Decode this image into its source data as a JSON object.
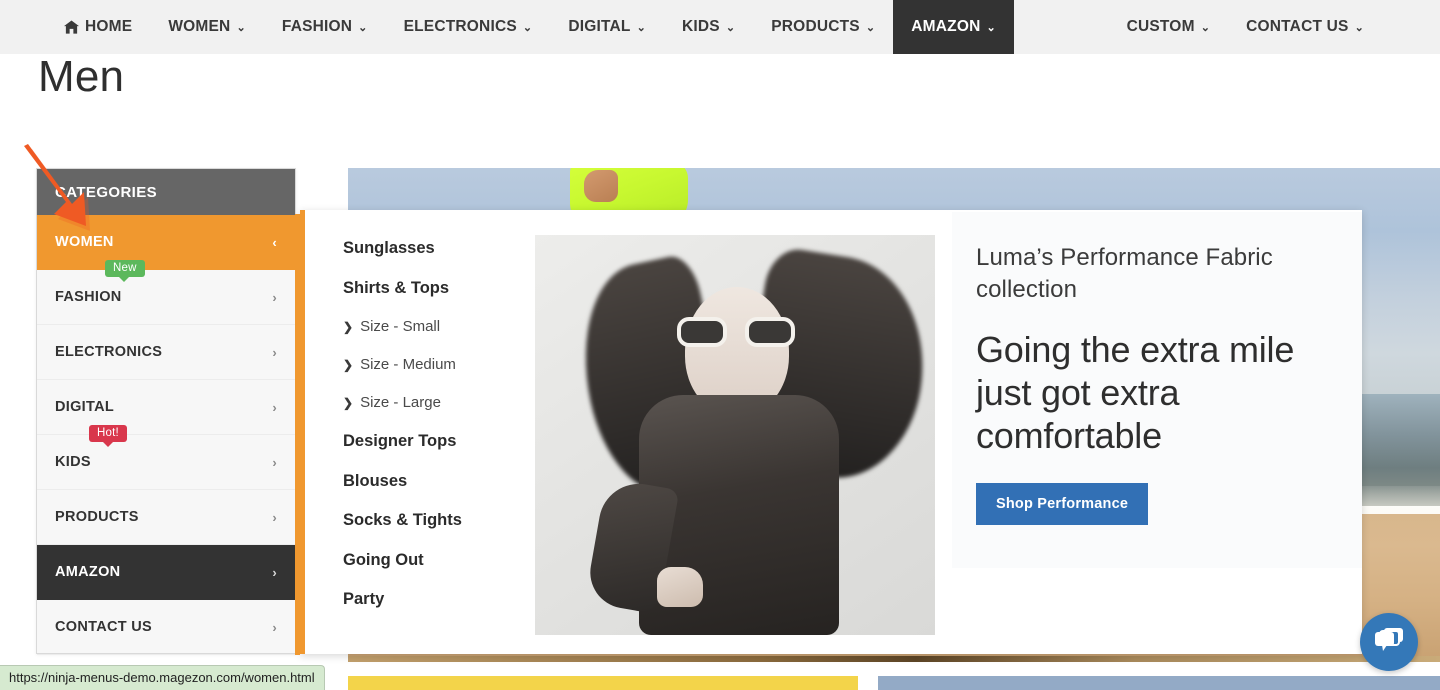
{
  "topnav": {
    "left_items": [
      {
        "label": "HOME",
        "icon": "home-icon",
        "caret": false,
        "active": false
      },
      {
        "label": "WOMEN",
        "icon": null,
        "caret": true,
        "active": false
      },
      {
        "label": "FASHION",
        "icon": null,
        "caret": true,
        "active": false
      },
      {
        "label": "ELECTRONICS",
        "icon": null,
        "caret": true,
        "active": false
      },
      {
        "label": "DIGITAL",
        "icon": null,
        "caret": true,
        "active": false
      },
      {
        "label": "KIDS",
        "icon": null,
        "caret": true,
        "active": false
      },
      {
        "label": "PRODUCTS",
        "icon": null,
        "caret": true,
        "active": false
      },
      {
        "label": "AMAZON",
        "icon": null,
        "caret": true,
        "active": true
      }
    ],
    "right_items": [
      {
        "label": "CUSTOM",
        "caret": true,
        "active": false
      },
      {
        "label": "CONTACT US",
        "caret": true,
        "active": false
      }
    ],
    "caret_glyph": "⌄",
    "background": "#f1f1f1",
    "active_background": "#333333"
  },
  "page_title": "Men",
  "sidebar": {
    "header": "CATEGORIES",
    "header_background": "#666666",
    "selected_background": "#f0982f",
    "dark_background": "#333333",
    "items": [
      {
        "label": "WOMEN",
        "arrow": "‹",
        "state": "selected",
        "badge": null
      },
      {
        "label": "FASHION",
        "arrow": "›",
        "state": "normal",
        "badge": {
          "text": "New",
          "color": "#5cb85c"
        }
      },
      {
        "label": "ELECTRONICS",
        "arrow": "›",
        "state": "normal",
        "badge": null
      },
      {
        "label": "DIGITAL",
        "arrow": "›",
        "state": "normal",
        "badge": null
      },
      {
        "label": "KIDS",
        "arrow": "›",
        "state": "normal",
        "badge": {
          "text": "Hot!",
          "color": "#d9374c"
        }
      },
      {
        "label": "PRODUCTS",
        "arrow": "›",
        "state": "normal",
        "badge": null
      },
      {
        "label": "AMAZON",
        "arrow": "›",
        "state": "dark",
        "badge": null
      },
      {
        "label": "CONTACT US",
        "arrow": "›",
        "state": "normal",
        "badge": null
      }
    ]
  },
  "megamenu": {
    "accent_color": "#f0982f",
    "links": [
      {
        "label": "Sunglasses",
        "sub": false
      },
      {
        "label": "Shirts & Tops",
        "sub": false
      },
      {
        "label": "Size - Small",
        "sub": true
      },
      {
        "label": "Size - Medium",
        "sub": true
      },
      {
        "label": "Size - Large",
        "sub": true
      },
      {
        "label": "Designer Tops",
        "sub": false
      },
      {
        "label": "Blouses",
        "sub": false
      },
      {
        "label": "Socks & Tights",
        "sub": false
      },
      {
        "label": "Going Out",
        "sub": false
      },
      {
        "label": "Party",
        "sub": false
      }
    ],
    "sub_chevron": "❯",
    "photo_alt": "black-and-white fashion model wearing sunglasses"
  },
  "promo": {
    "subtitle": "Luma’s Performance Fabric collection",
    "title": "Going the extra mile just got extra comfortable",
    "button_label": "Shop Performance",
    "button_color": "#3270b5"
  },
  "chat_widget": {
    "icon": "chat-bubble-icon",
    "color": "#3478b8"
  },
  "statusbar": {
    "url": "https://ninja-menus-demo.magezon.com/women.html"
  },
  "annotation": {
    "arrow_color": "#ef5a24",
    "points_to": "WOMEN"
  }
}
